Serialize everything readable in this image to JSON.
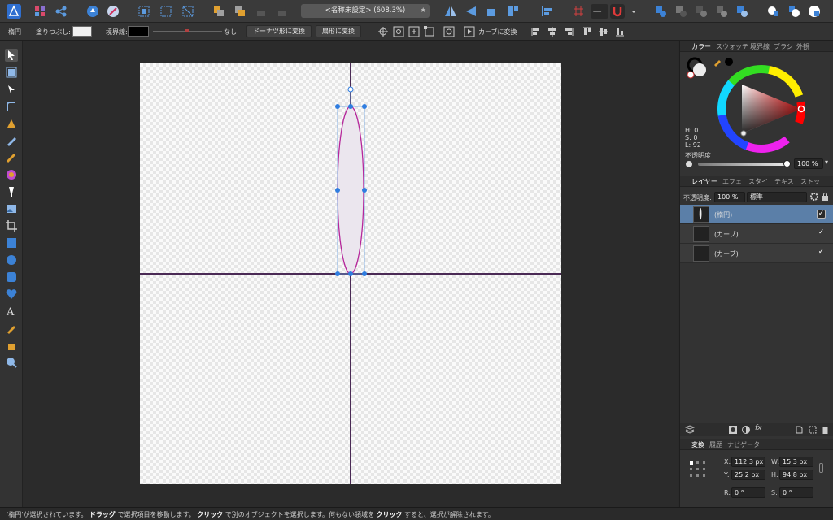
{
  "colors": {
    "accent_blue": "#3c82d6",
    "selection_row": "#5b7fa8",
    "ellipse_stroke": "#b5279b",
    "guide_line": "#4a2a55",
    "handle_blue": "#2f7de0"
  },
  "toolbar": {
    "document_title": "<名称未設定> (608.3%)",
    "star": "★",
    "icons": [
      "affinity-logo-icon",
      "pixel-persona-icon",
      "export-persona-icon",
      "assistant-icon",
      "snapping-icon",
      "select-all-icon",
      "select-none-icon",
      "invert-selection-icon",
      "arrange-icon",
      "arrange-front-icon",
      "lock-icon",
      "unlock-icon",
      "flip-horizontal-icon",
      "flip-vertical-icon",
      "rotate-icon",
      "align-icon",
      "grid-icon",
      "magnet-icon",
      "boolean-add-icon",
      "boolean-subtract-icon",
      "boolean-intersect-icon",
      "boolean-xor-icon",
      "boolean-divide-icon",
      "insert-front-icon",
      "insert-back-icon",
      "insert-inside-icon"
    ]
  },
  "context_bar": {
    "tool_name": "楕円",
    "fill_label": "塗りつぶし:",
    "stroke_label": "境界線:",
    "stroke_none": "なし",
    "donut_button": "ドーナツ形に変換",
    "pie_button": "扇形に変換",
    "curve_button": "カーブに変換"
  },
  "tools": [
    "move-tool-icon",
    "artboard-tool-icon",
    "node-tool-icon",
    "corner-tool-icon",
    "pen-tool-icon",
    "pencil-tool-icon",
    "vector-brush-icon",
    "fill-tool-icon",
    "transparency-tool-icon",
    "place-image-icon",
    "crop-tool-icon",
    "rectangle-tool-icon",
    "ellipse-tool-icon",
    "rounded-rect-tool-icon",
    "heart-tool-icon",
    "text-tool-icon",
    "color-picker-icon",
    "hand-tool-icon",
    "zoom-tool-icon"
  ],
  "color_panel": {
    "tabs": [
      "カラー",
      "スウォッチ",
      "境界線",
      "ブラシ",
      "外観"
    ],
    "h": "H: 0",
    "s": "S: 0",
    "l": "L: 92",
    "opacity_label": "不透明度",
    "opacity_value": "100 %"
  },
  "layers_panel": {
    "tabs": [
      "レイヤー",
      "エフェ",
      "スタイ",
      "テキス",
      "ストッ"
    ],
    "opacity_label": "不透明度:",
    "opacity_value": "100 %",
    "blend_mode": "標準",
    "layers": [
      {
        "name": "(楕円)",
        "selected": true,
        "checked": "✓"
      },
      {
        "name": "(カーブ)",
        "selected": false,
        "checked": "✓"
      },
      {
        "name": "(カーブ)",
        "selected": false,
        "checked": "✓"
      }
    ]
  },
  "transform_panel": {
    "tabs": [
      "変換",
      "履歴",
      "ナビゲータ"
    ],
    "x_label": "X:",
    "x_value": "112.3 px",
    "y_label": "Y:",
    "y_value": "25.2 px",
    "w_label": "W:",
    "w_value": "15.3 px",
    "h_label": "H:",
    "h_value": "94.8 px",
    "r_label": "R:",
    "r_value": "0 °",
    "s_label": "S:",
    "s_value": "0 °"
  },
  "status": {
    "part1": "'楕円'が選択されています。",
    "bold1": "ドラッグ",
    "part2": "で選択項目を移動します。",
    "bold2": "クリック",
    "part3": "で別のオブジェクトを選択します。何もない領域を",
    "bold3": "クリック",
    "part4": "すると、選択が解除されます。"
  }
}
